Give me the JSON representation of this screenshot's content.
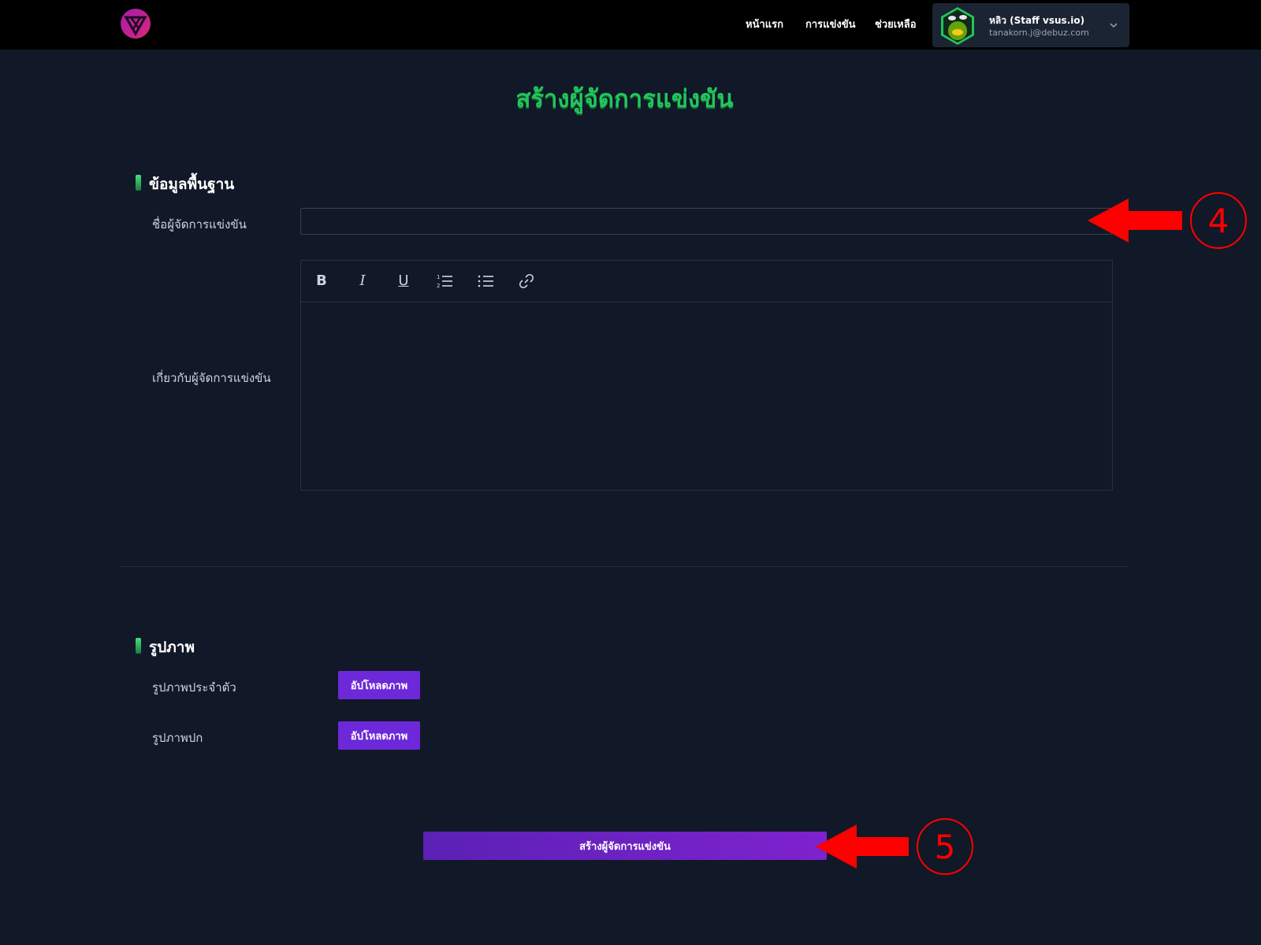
{
  "header": {
    "nav": [
      "หน้าแรก",
      "การแข่งขัน",
      "ช่วยเหลือ"
    ],
    "profile": {
      "name": "หลิว (Staff vsus.io)",
      "email": "tanakorn.j@debuz.com"
    }
  },
  "page": {
    "title": "สร้างผู้จัดการแข่งขัน"
  },
  "basic_info": {
    "heading": "ข้อมูลพื้นฐาน",
    "name_label": "ชื่อผู้จัดการแข่งขัน",
    "name_value": "",
    "about_label": "เกี่ยวกับผู้จัดการแข่งขัน",
    "toolbar": {
      "bold": "B",
      "italic": "I",
      "underline": "U"
    }
  },
  "images": {
    "heading": "รูปภาพ",
    "profile_label": "รูปภาพประจำตัว",
    "cover_label": "รูปภาพปก",
    "upload_label": "อัปโหลดภาพ"
  },
  "submit_label": "สร้างผู้จัดการแข่งขัน",
  "annotations": [
    "4",
    "5"
  ],
  "colors": {
    "background": "#111827",
    "accent_purple": "#6d28d9",
    "title_green": "#22c55e",
    "annotation_red": "#ff0000"
  }
}
